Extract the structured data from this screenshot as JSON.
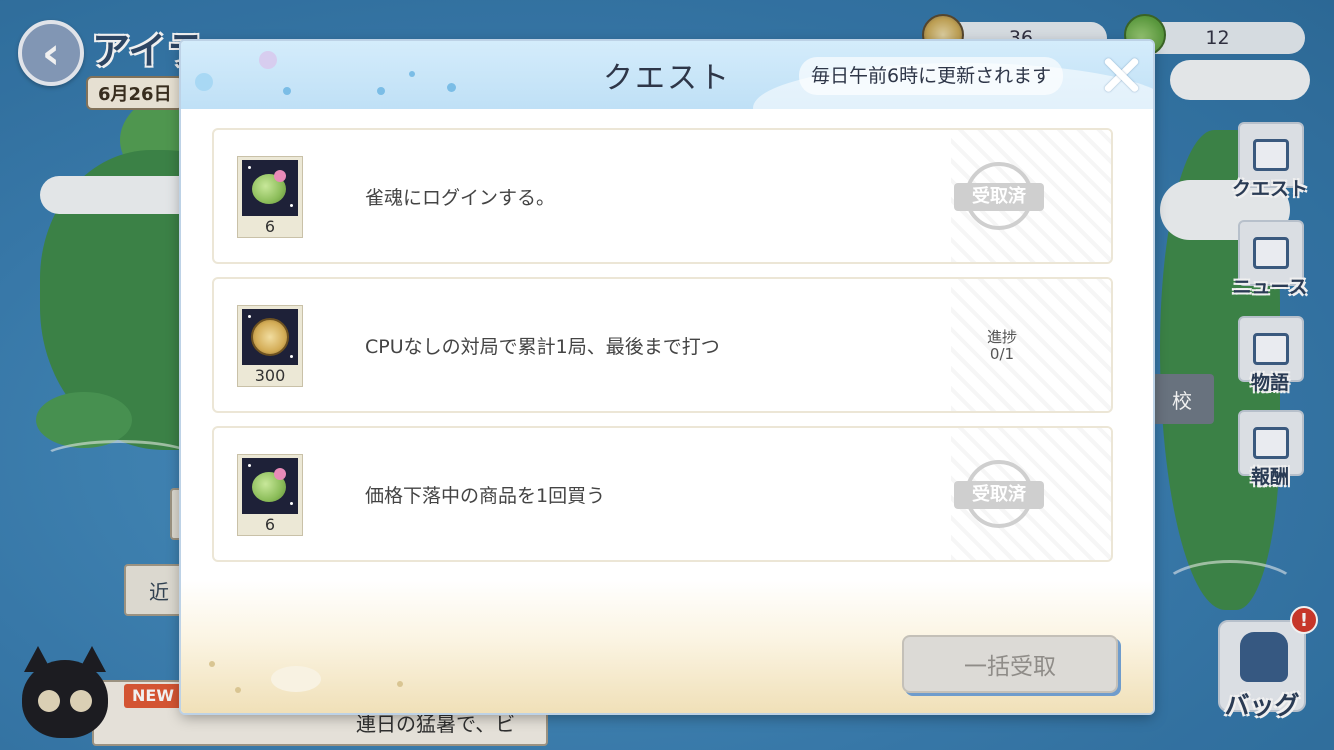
{
  "background": {
    "map_title": "アイラ",
    "date": "6月26日",
    "back_icon": "chevron-left-icon",
    "currency": [
      {
        "icon": "shell-coin-icon",
        "value": "36"
      },
      {
        "icon": "coconut-icon",
        "value": "12"
      }
    ],
    "side_menu": [
      {
        "icon": "quest-icon",
        "label": "クエスト"
      },
      {
        "icon": "news-icon",
        "label": "ニュース"
      },
      {
        "icon": "camera-icon",
        "label": "物語"
      },
      {
        "icon": "reward-icon",
        "label": "報酬"
      }
    ],
    "school_tag": "校",
    "left_tab": "近",
    "bag": {
      "label": "バッグ",
      "alert": "!"
    },
    "news": {
      "badge": "NEW",
      "text": "連日の猛暑で、ビ"
    }
  },
  "modal": {
    "title": "クエスト",
    "refresh_note": "毎日午前6時に更新されます",
    "close_icon": "close-icon",
    "quests": [
      {
        "reward_icon": "coconut-icon",
        "reward_count": "6",
        "text": "雀魂にログインする。",
        "status": "受取済"
      },
      {
        "reward_icon": "shell-coin-icon",
        "reward_count": "300",
        "text": "CPUなしの対局で累計1局、最後まで打つ",
        "progress_label": "進捗",
        "progress_value": "0/1"
      },
      {
        "reward_icon": "coconut-icon",
        "reward_count": "6",
        "text": "価格下落中の商品を1回買う",
        "status": "受取済"
      }
    ],
    "collect_all_label": "一括受取",
    "colors": {
      "header": "#c8e6f8",
      "claimed_stamp": "#cfcfcf",
      "button_shadow": "#6f9ccc"
    }
  }
}
